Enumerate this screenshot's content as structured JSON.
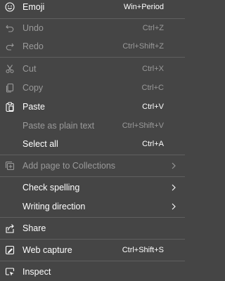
{
  "colors": {
    "background": "#454545",
    "text_enabled": "#ffffff",
    "text_disabled": "#9a9a9a",
    "divider": "#5f5f5f"
  },
  "menu": {
    "emoji": {
      "label": "Emoji",
      "shortcut": "Win+Period",
      "icon": "emoji-icon"
    },
    "undo": {
      "label": "Undo",
      "shortcut": "Ctrl+Z",
      "icon": "undo-icon"
    },
    "redo": {
      "label": "Redo",
      "shortcut": "Ctrl+Shift+Z",
      "icon": "redo-icon"
    },
    "cut": {
      "label": "Cut",
      "shortcut": "Ctrl+X",
      "icon": "cut-icon"
    },
    "copy": {
      "label": "Copy",
      "shortcut": "Ctrl+C",
      "icon": "copy-icon"
    },
    "paste": {
      "label": "Paste",
      "shortcut": "Ctrl+V",
      "icon": "paste-icon"
    },
    "paste_plain": {
      "label": "Paste as plain text",
      "shortcut": "Ctrl+Shift+V"
    },
    "select_all": {
      "label": "Select all",
      "shortcut": "Ctrl+A"
    },
    "add_collections": {
      "label": "Add page to Collections",
      "icon": "collections-icon"
    },
    "check_spelling": {
      "label": "Check spelling"
    },
    "writing_direction": {
      "label": "Writing direction"
    },
    "share": {
      "label": "Share",
      "icon": "share-icon"
    },
    "web_capture": {
      "label": "Web capture",
      "shortcut": "Ctrl+Shift+S",
      "icon": "web-capture-icon"
    },
    "inspect": {
      "label": "Inspect",
      "icon": "inspect-icon"
    }
  }
}
